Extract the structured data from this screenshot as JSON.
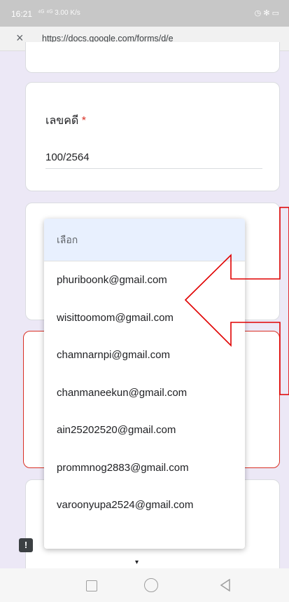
{
  "status_bar": {
    "time": "16:21",
    "signal": "⁴ᴳ ⁴ᴳ 3.00 K/s",
    "right_icons": "◷ ✻ ▭"
  },
  "browser": {
    "close_symbol": "×",
    "url": "https://docs.google.com/forms/d/e"
  },
  "form": {
    "question_label": "เลขคดี",
    "required_mark": "*",
    "answer_value": "100/2564"
  },
  "dropdown": {
    "placeholder": "เลือก",
    "options": [
      "phuriboonk@gmail.com",
      "wisittoomom@gmail.com",
      "chamnarnpi@gmail.com",
      "chanmaneekun@gmail.com",
      "ain25202520@gmail.com",
      "prommnog2883@gmail.com",
      "varoonyupa2524@gmail.com"
    ],
    "scroll_hint": "▾"
  },
  "feedback_label": "!",
  "colors": {
    "required": "#d93025",
    "error_outline": "#d93025",
    "annotation_arrow": "#e00000",
    "highlight": "#e8f0fe"
  }
}
